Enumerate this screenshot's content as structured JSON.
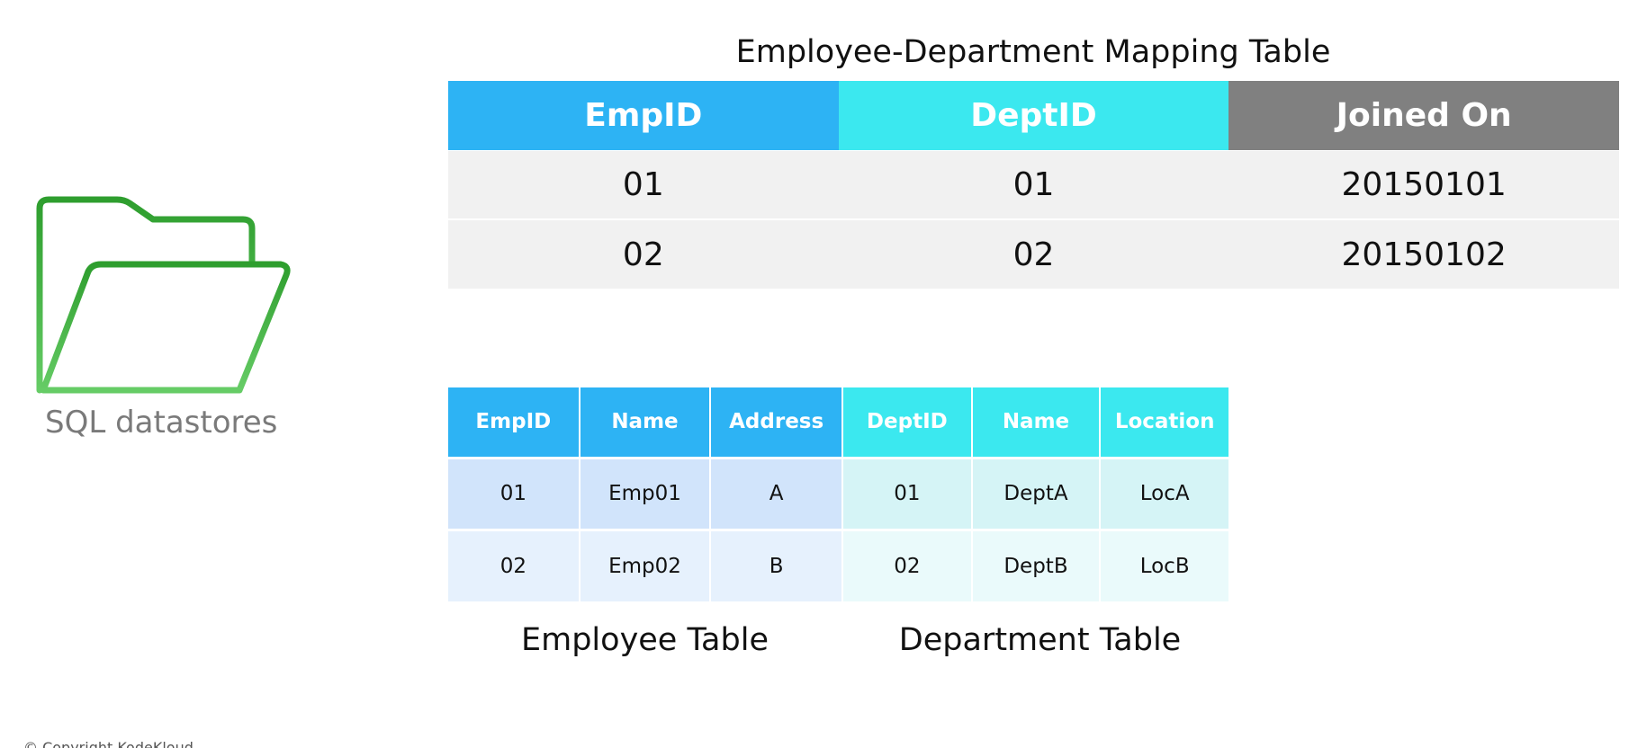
{
  "folder": {
    "icon": "folder-icon",
    "label": "SQL datastores",
    "color_dark": "#2e9e2e",
    "color_light": "#5cc45c"
  },
  "mapping_table": {
    "title": "Employee-Department Mapping Table",
    "headers": [
      "EmpID",
      "DeptID",
      "Joined On"
    ],
    "header_colors": [
      "#2db3f4",
      "#3be8ef",
      "#808080"
    ],
    "rows": [
      [
        "01",
        "01",
        "20150101"
      ],
      [
        "02",
        "02",
        "20150102"
      ]
    ]
  },
  "employee_table": {
    "caption": "Employee Table",
    "headers": [
      "EmpID",
      "Name",
      "Address"
    ],
    "rows": [
      [
        "01",
        "Emp01",
        "A"
      ],
      [
        "02",
        "Emp02",
        "B"
      ]
    ]
  },
  "department_table": {
    "caption": "Department Table",
    "headers": [
      "DeptID",
      "Name",
      "Location"
    ],
    "rows": [
      [
        "01",
        "DeptA",
        "LocA"
      ],
      [
        "02",
        "DeptB",
        "LocB"
      ]
    ]
  },
  "footer": {
    "copyright": "© Copyright KodeKloud"
  }
}
